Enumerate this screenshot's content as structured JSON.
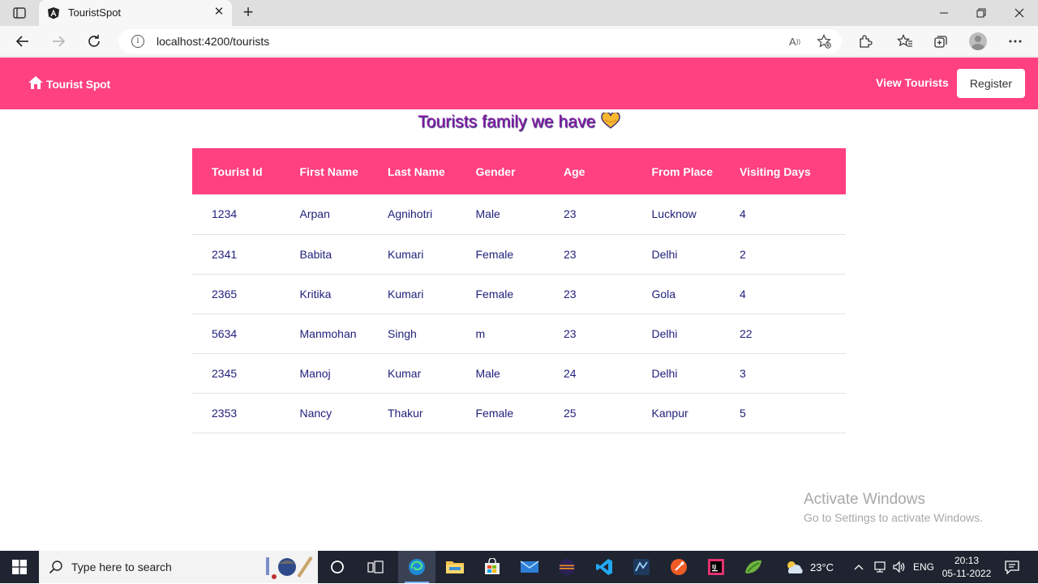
{
  "browser": {
    "tab_title": "TouristSpot",
    "url": "localhost:4200/tourists"
  },
  "app": {
    "brand": "Tourist Spot",
    "nav_view_tourists": "View Tourists",
    "nav_register": "Register",
    "accent_color": "#ff4081"
  },
  "page": {
    "title": "Tourists family we have"
  },
  "table": {
    "headers": [
      "Tourist Id",
      "First Name",
      "Last Name",
      "Gender",
      "Age",
      "From Place",
      "Visiting Days"
    ],
    "rows": [
      [
        "1234",
        "Arpan",
        "Agnihotri",
        "Male",
        "23",
        "Lucknow",
        "4"
      ],
      [
        "2341",
        "Babita",
        "Kumari",
        "Female",
        "23",
        "Delhi",
        "2"
      ],
      [
        "2365",
        "Kritika",
        "Kumari",
        "Female",
        "23",
        "Gola",
        "4"
      ],
      [
        "5634",
        "Manmohan",
        "Singh",
        "m",
        "23",
        "Delhi",
        "22"
      ],
      [
        "2345",
        "Manoj",
        "Kumar",
        "Male",
        "24",
        "Delhi",
        "3"
      ],
      [
        "2353",
        "Nancy",
        "Thakur",
        "Female",
        "25",
        "Kanpur",
        "5"
      ]
    ]
  },
  "watermark": {
    "title": "Activate Windows",
    "subtitle": "Go to Settings to activate Windows."
  },
  "taskbar": {
    "search_placeholder": "Type here to search",
    "weather": "23°C",
    "language": "ENG",
    "time": "20:13",
    "date": "05-11-2022"
  }
}
